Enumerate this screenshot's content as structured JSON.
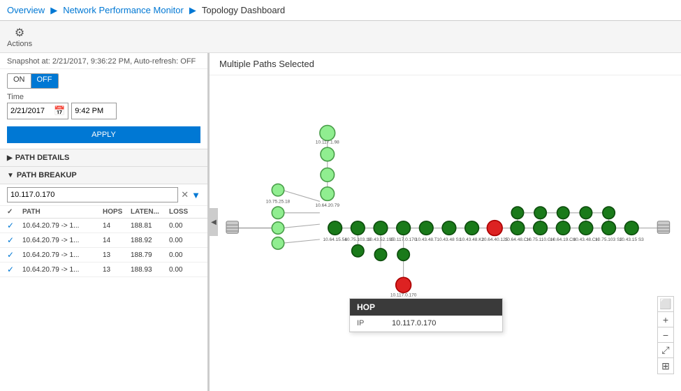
{
  "breadcrumb": {
    "overview": "Overview",
    "sep1": "▶",
    "npm": "Network Performance Monitor",
    "sep2": "▶",
    "topology": "Topology Dashboard"
  },
  "toolbar": {
    "actions_icon": "⚙",
    "actions_label": "Actions"
  },
  "left_panel": {
    "snapshot_text": "Snapshot at: 2/21/2017, 9:36:22 PM, Auto-refresh: OFF",
    "toggle_on": "ON",
    "toggle_off": "OFF",
    "time_label": "Time",
    "date_value": "2/21/2017",
    "time_value": "9:42 PM",
    "apply_label": "APPLY",
    "path_details_label": "PATH DETAILS",
    "path_breakup_label": "PATH BREAKUP",
    "filter_value": "10.117.0.170",
    "table": {
      "headers": [
        "✓",
        "PATH",
        "HOPS",
        "LATEN...",
        "LOSS"
      ],
      "rows": [
        {
          "checked": true,
          "path": "10.64.20.79 -> 1...",
          "hops": "14",
          "latency": "188.81",
          "loss": "0.00"
        },
        {
          "checked": true,
          "path": "10.64.20.79 -> 1...",
          "hops": "14",
          "latency": "188.92",
          "loss": "0.00"
        },
        {
          "checked": true,
          "path": "10.64.20.79 -> 1...",
          "hops": "13",
          "latency": "188.79",
          "loss": "0.00"
        },
        {
          "checked": true,
          "path": "10.64.20.79 -> 1...",
          "hops": "13",
          "latency": "188.93",
          "loss": "0.00"
        }
      ]
    }
  },
  "right_panel": {
    "title": "Multiple Paths Selected",
    "hop_popup": {
      "header": "HOP",
      "label": "IP",
      "value": "10.117.0.170"
    }
  },
  "zoom_controls": {
    "expand": "⬜",
    "plus": "+",
    "minus": "−",
    "arrows": "⤢",
    "grid": "⊞"
  }
}
